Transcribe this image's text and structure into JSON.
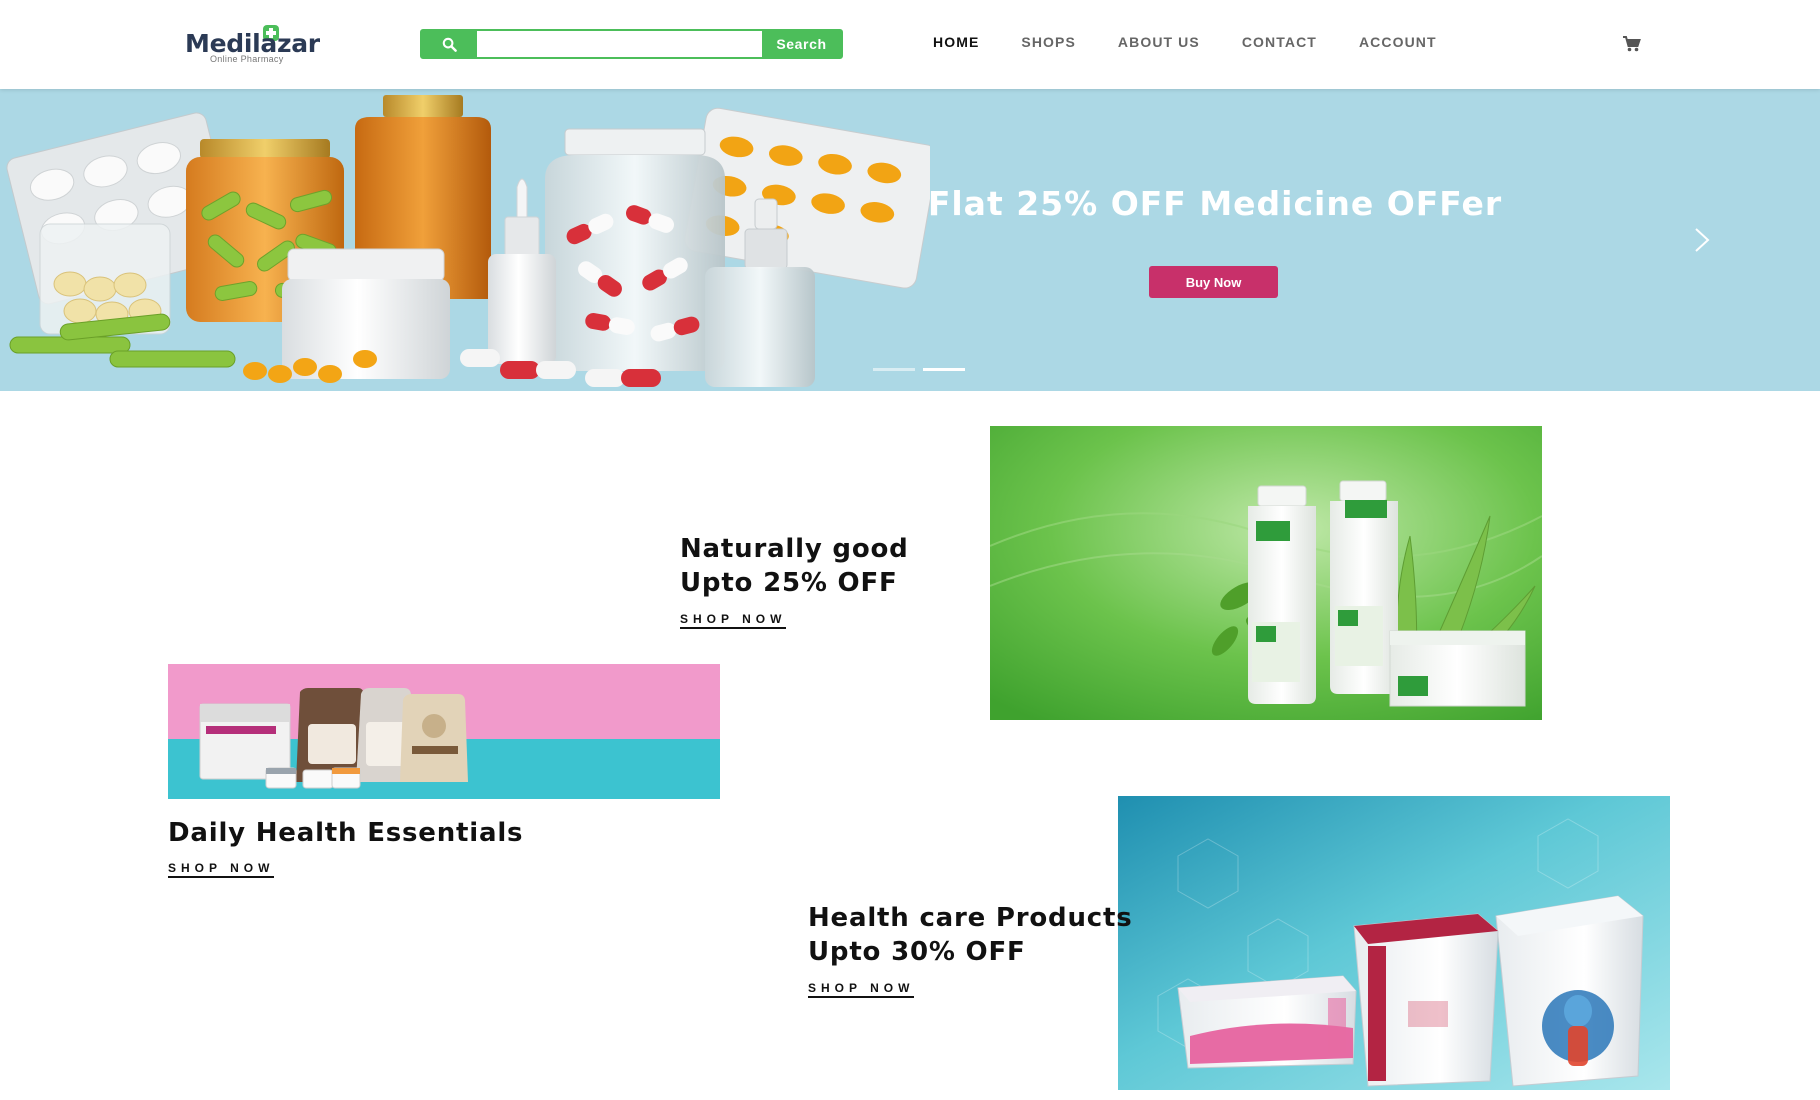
{
  "brand": {
    "name": "Medilazar",
    "tagline": "Online Pharmacy"
  },
  "search": {
    "placeholder": "",
    "button_label": "Search"
  },
  "nav": {
    "items": [
      "HOME",
      "SHOPS",
      "ABOUT US",
      "CONTACT",
      "ACCOUNT"
    ],
    "active": "HOME"
  },
  "hero": {
    "title": "Flat 25% OFF Medicine OFFer",
    "button_label": "Buy Now",
    "slides": 2,
    "active_slide": 2,
    "background": "#acd8e5",
    "button_color": "#c8306a"
  },
  "promos": [
    {
      "line1": "Naturally good",
      "line2": "Upto 25% OFF",
      "link": "SHOP NOW"
    },
    {
      "line1": "Daily Health Essentials",
      "line2": "",
      "link": "SHOP NOW"
    },
    {
      "line1": "Health care Products",
      "line2": "Upto 30% OFF",
      "link": "SHOP NOW"
    }
  ],
  "colors": {
    "accent_green": "#4cbe5a",
    "text_dark": "#111111",
    "nav_gray": "#666666"
  },
  "icons": [
    "search-icon",
    "cart-icon",
    "chevron-right-icon"
  ]
}
